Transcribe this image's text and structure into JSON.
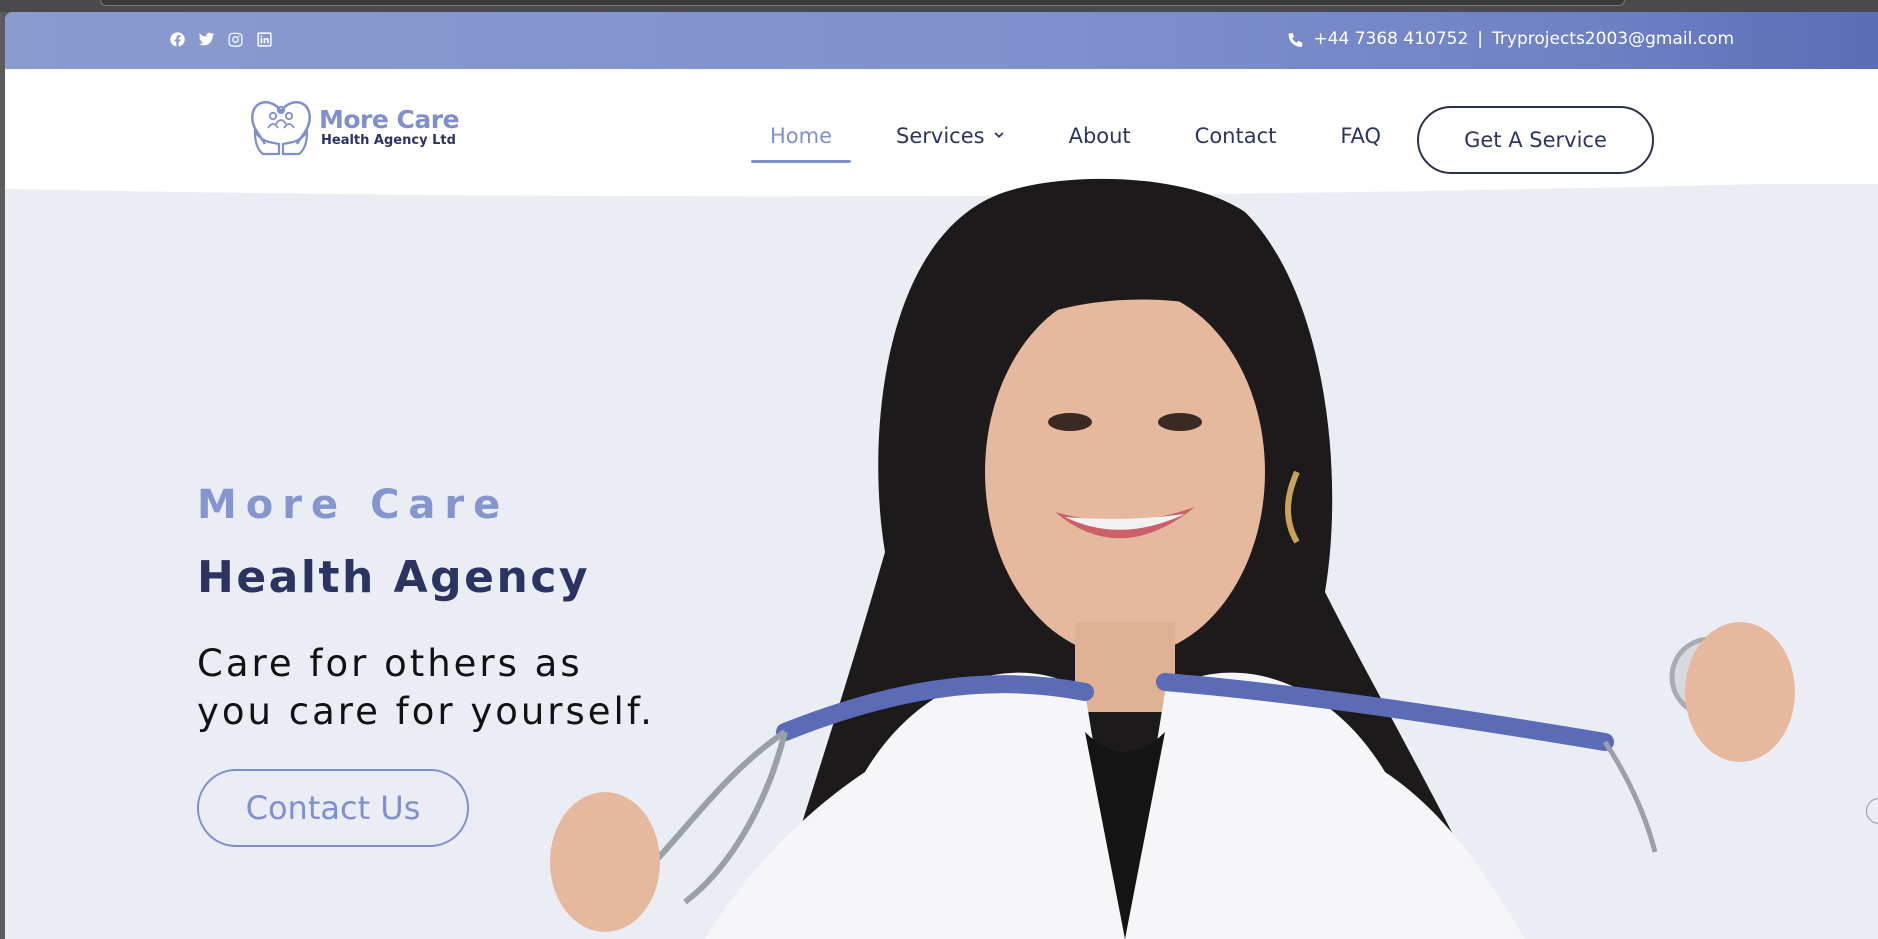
{
  "topbar": {
    "socials": [
      {
        "icon": "facebook-icon"
      },
      {
        "icon": "twitter-icon"
      },
      {
        "icon": "instagram-icon"
      },
      {
        "icon": "linkedin-icon"
      }
    ],
    "phone": "+44 7368 410752",
    "separator": "|",
    "email": "Tryprojects2003@gmail.com"
  },
  "logo": {
    "title": "More Care",
    "subtitle": "Health Agency Ltd"
  },
  "nav": {
    "items": [
      {
        "label": "Home",
        "active": true
      },
      {
        "label": "Services",
        "dropdown": true
      },
      {
        "label": "About"
      },
      {
        "label": "Contact"
      },
      {
        "label": "FAQ"
      }
    ],
    "cta": "Get A Service"
  },
  "hero": {
    "eyebrow": "More Care",
    "title": "Health Agency",
    "tagline": "Care for others as you care for yourself.",
    "button": "Contact Us"
  },
  "colors": {
    "accent": "#7f90cc",
    "navy": "#2b3461",
    "hero_bg": "#eaedf4"
  }
}
